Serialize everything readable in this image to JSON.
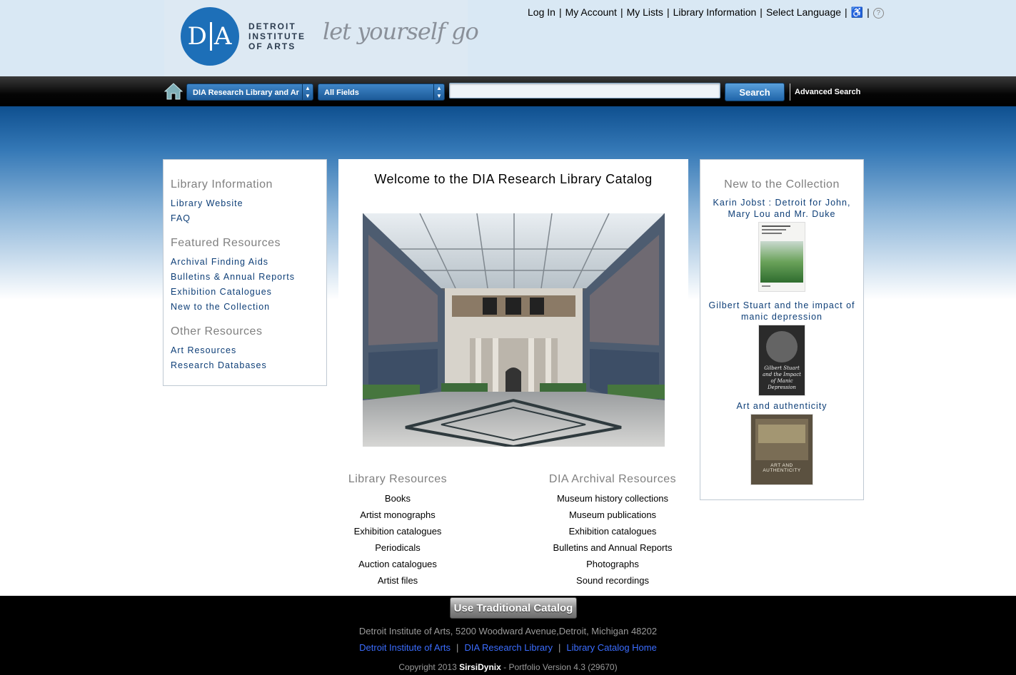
{
  "header": {
    "logo_text": "DIA",
    "institution_name": "DETROIT\nINSTITUTE\nOF ARTS",
    "tagline": "let yourself go",
    "util_nav": [
      "Log In",
      "My Account",
      "My Lists",
      "Library Information",
      "Select Language"
    ],
    "accessibility_icon": "wheelchair-icon",
    "help_icon": "help-icon"
  },
  "search": {
    "library_select": "DIA Research Library and Ar",
    "field_select": "All Fields",
    "input_value": "",
    "button_label": "Search",
    "advanced_label": "Advanced Search",
    "home_icon": "home-icon"
  },
  "left_panel": {
    "sections": [
      {
        "heading": "Library Information",
        "links": [
          "Library Website",
          "FAQ"
        ]
      },
      {
        "heading": "Featured Resources",
        "links": [
          "Archival Finding Aids",
          "Bulletins & Annual Reports",
          "Exhibition Catalogues",
          "New to the Collection"
        ]
      },
      {
        "heading": "Other Resources",
        "links": [
          "Art Resources",
          "Research Databases"
        ]
      }
    ]
  },
  "center": {
    "title": "Welcome to the DIA Research Library Catalog",
    "library_resources": {
      "heading": "Library Resources",
      "items": [
        "Books",
        "Artist monographs",
        "Exhibition catalogues",
        "Periodicals",
        "Auction catalogues",
        "Artist files"
      ]
    },
    "archival_resources": {
      "heading": "DIA Archival Resources",
      "items": [
        "Museum history collections",
        "Museum publications",
        "Exhibition catalogues",
        "Bulletins and Annual Reports",
        "Photographs",
        "Sound recordings"
      ]
    }
  },
  "right_panel": {
    "heading": "New to the Collection",
    "items": [
      {
        "title": "Karin Jobst : Detroit for John, Mary Lou and Mr. Duke"
      },
      {
        "title": "Gilbert Stuart and the impact of manic depression",
        "cover_text": "Gilbert Stuart and the Impact of Manic Depression"
      },
      {
        "title": "Art and authenticity",
        "cover_text": "ART AND AUTHENTICITY"
      }
    ]
  },
  "footer": {
    "button_label": "Use Traditional Catalog",
    "address": "Detroit Institute of Arts, 5200 Woodward Avenue,Detroit, Michigan 48202",
    "links": [
      "Detroit Institute of Arts",
      "DIA Research Library",
      "Library Catalog Home"
    ],
    "copyright_prefix": "Copyright 2013 ",
    "copyright_brand": "SirsiDynix",
    "copyright_suffix": " - Portfolio Version 4.3 (29670)"
  }
}
